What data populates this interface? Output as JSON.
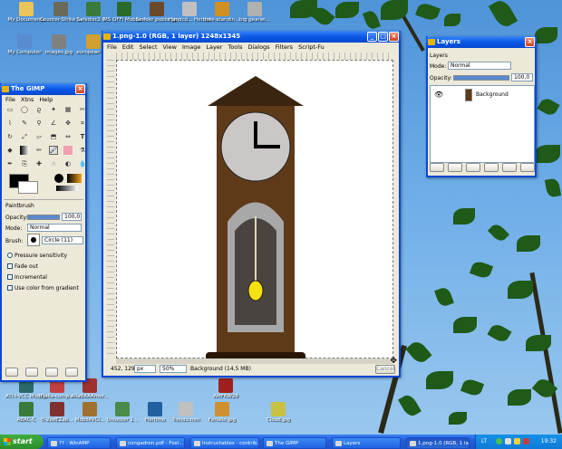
{
  "desktop": {
    "icons": [
      {
        "label": "My Documents",
        "color": "#e8c45a"
      },
      {
        "label": "Counter-Strike Source",
        "color": "#6a6a5a"
      },
      {
        "label": "Safedisc2.0...",
        "color": "#3a7a3a"
      },
      {
        "label": "MS OFFI Mobile Ass",
        "color": "#2a6a2a"
      },
      {
        "label": "Sender public.jpg",
        "color": "#6a4a2a"
      },
      {
        "label": "Handcd... Herbal",
        "color": "#c0c0c0"
      },
      {
        "label": "free-standin...",
        "color": "#d09020"
      },
      {
        "label": "big gearwi...",
        "color": "#b0b0b0"
      },
      {
        "label": "My Computer",
        "color": "#5a8ad0"
      },
      {
        "label": "images.jpg",
        "color": "#808080"
      },
      {
        "label": "european_s...",
        "color": "#d0a030"
      },
      {
        "label": "ATI-I-VCC Modulare",
        "color": "#2a6a6a"
      },
      {
        "label": "Fjolla-comp...",
        "color": "#c04040"
      },
      {
        "label": "AllaBAAAmor...",
        "color": "#a03030"
      },
      {
        "label": "AMFKW28",
        "color": "#a02020"
      },
      {
        "label": "ABAC-C",
        "color": "#3a7a3a"
      },
      {
        "label": "tl-2eeEZap...",
        "color": "#803030"
      },
      {
        "label": "MobileVCI...",
        "color": "#a07030"
      },
      {
        "label": "Unlocker 1...",
        "color": "#4a8a4a"
      },
      {
        "label": "Hurtimo",
        "color": "#2060a0"
      },
      {
        "label": "Trendo.mm",
        "color": "#c0c0c0"
      },
      {
        "label": "Fenulle.jpg",
        "color": "#d09030"
      },
      {
        "label": "Cloud.jpg",
        "color": "#c8c040"
      }
    ]
  },
  "toolbox": {
    "title": "The GIMP",
    "menu": [
      "File",
      "Xtns",
      "Help"
    ],
    "fg_color": "#000000",
    "bg_color": "#ffffff",
    "paintbrush": {
      "header": "Paintbrush",
      "opacity_label": "Opacity:",
      "opacity_value": "100,0",
      "mode_label": "Mode:",
      "mode_value": "Normal",
      "brush_label": "Brush:",
      "brush_value": "Circle (11)",
      "pressure_label": "Pressure sensitivity",
      "fade_label": "Fade out",
      "incremental_label": "Incremental",
      "gradient_label": "Use color from gradient"
    }
  },
  "image_window": {
    "title": "1.png-1.0 (RGB, 1 layer) 1248x1345",
    "menu": [
      "File",
      "Edit",
      "Select",
      "View",
      "Image",
      "Layer",
      "Tools",
      "Dialogs",
      "Filters",
      "Script-Fu"
    ],
    "coords": "452, 1296",
    "unit": "px",
    "zoom": "50%",
    "status": "Background (14,5 MB)",
    "cancel_label": "Cancel"
  },
  "layers": {
    "title": "Layers",
    "header": "Layers",
    "mode_label": "Mode:",
    "mode_value": "Normal",
    "opacity_label": "Opacity:",
    "opacity_value": "100,0",
    "layer_name": "Background"
  },
  "taskbar": {
    "start_label": "start",
    "items": [
      "?? - WinAMP",
      "congadron.pdf - Foxi...",
      "Instructables - contrib...",
      "The GIMP",
      "Layers",
      "1.png-1.0 (RGB, 1 la..."
    ],
    "lang": "LT",
    "clock": "19:32"
  }
}
